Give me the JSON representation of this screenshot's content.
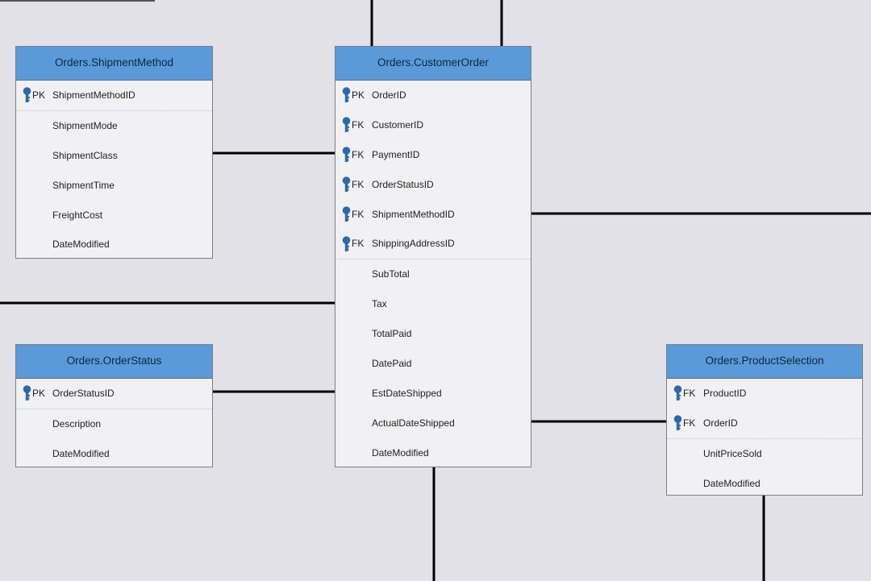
{
  "entities": {
    "shipment_method": {
      "title": "Orders.ShipmentMethod",
      "rows": [
        {
          "key": "PK",
          "name": "ShipmentMethodID"
        },
        {
          "key": "",
          "name": "ShipmentMode"
        },
        {
          "key": "",
          "name": "ShipmentClass"
        },
        {
          "key": "",
          "name": "ShipmentTime"
        },
        {
          "key": "",
          "name": "FreightCost"
        },
        {
          "key": "",
          "name": "DateModified"
        }
      ]
    },
    "customer_order": {
      "title": "Orders.CustomerOrder",
      "rows": [
        {
          "key": "PK",
          "name": "OrderID"
        },
        {
          "key": "FK",
          "name": "CustomerID"
        },
        {
          "key": "FK",
          "name": "PaymentID"
        },
        {
          "key": "FK",
          "name": "OrderStatusID"
        },
        {
          "key": "FK",
          "name": "ShipmentMethodID"
        },
        {
          "key": "FK",
          "name": "ShippingAddressID"
        },
        {
          "key": "",
          "name": "SubTotal"
        },
        {
          "key": "",
          "name": "Tax"
        },
        {
          "key": "",
          "name": "TotalPaid"
        },
        {
          "key": "",
          "name": "DatePaid"
        },
        {
          "key": "",
          "name": "EstDateShipped"
        },
        {
          "key": "",
          "name": "ActualDateShipped"
        },
        {
          "key": "",
          "name": "DateModified"
        }
      ]
    },
    "order_status": {
      "title": "Orders.OrderStatus",
      "rows": [
        {
          "key": "PK",
          "name": "OrderStatusID"
        },
        {
          "key": "",
          "name": "Description"
        },
        {
          "key": "",
          "name": "DateModified"
        }
      ]
    },
    "product_selection": {
      "title": "Orders.ProductSelection",
      "rows": [
        {
          "key": "FK",
          "name": "ProductID"
        },
        {
          "key": "FK",
          "name": "OrderID"
        },
        {
          "key": "",
          "name": "UnitPriceSold"
        },
        {
          "key": "",
          "name": "DateModified"
        }
      ]
    }
  },
  "colors": {
    "header": "#5b9ad8",
    "key_icon": "#2e6aa8",
    "background": "#e1e1e7",
    "body": "#f1f1f3",
    "connector": "#000000"
  },
  "icons": {
    "key": "key-icon"
  }
}
